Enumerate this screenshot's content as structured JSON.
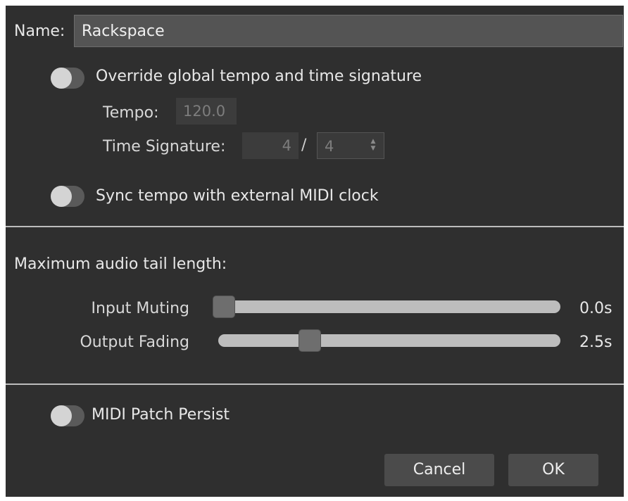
{
  "name_field": {
    "label": "Name:",
    "value": "Rackspace"
  },
  "tempo_section": {
    "override_label": "Override global tempo and time signature",
    "override_on": false,
    "tempo_label": "Tempo:",
    "tempo_value": "120.0",
    "time_sig_label": "Time Signature:",
    "time_sig_numerator": "4",
    "time_sig_separator": "/",
    "time_sig_denominator": "4",
    "sync_label": "Sync tempo with external MIDI clock",
    "sync_on": false
  },
  "audio_tail": {
    "heading": "Maximum audio tail length:",
    "input_muting": {
      "label": "Input Muting",
      "value_text": "0.0s",
      "fraction": 0.0
    },
    "output_fading": {
      "label": "Output Fading",
      "value_text": "2.5s",
      "fraction": 0.25
    }
  },
  "midi_patch_persist": {
    "label": "MIDI Patch Persist",
    "on": false
  },
  "buttons": {
    "cancel": "Cancel",
    "ok": "OK"
  },
  "colors": {
    "background": "#2f2f2f",
    "track": "#bdbdbd",
    "button": "#4b4b4b"
  }
}
